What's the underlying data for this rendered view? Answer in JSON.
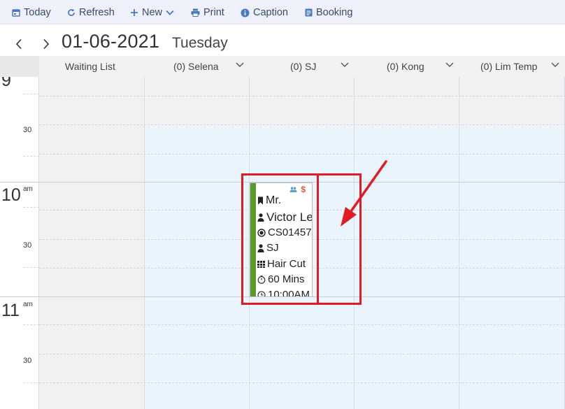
{
  "toolbar": {
    "today": "Today",
    "refresh": "Refresh",
    "new": "New",
    "print": "Print",
    "caption": "Caption",
    "booking": "Booking"
  },
  "date_header": {
    "date": "01-06-2021",
    "day": "Tuesday"
  },
  "columns": [
    {
      "label": "Waiting List"
    },
    {
      "label": "(0) Selena"
    },
    {
      "label": "(0) SJ"
    },
    {
      "label": "(0) Kong"
    },
    {
      "label": "(0) Lim Temp"
    }
  ],
  "time_labels": {
    "hour_9": "9",
    "half_1": "30",
    "hour_10": "10",
    "ampm_10": "am",
    "half_2": "30",
    "hour_11": "11",
    "ampm_11": "am",
    "half_3": "30"
  },
  "appointment": {
    "title": "Mr.",
    "name": "Victor Le",
    "code": "CS01457",
    "staff": "SJ",
    "service": "Hair Cut",
    "duration": "60 Mins",
    "time": "10:00AM",
    "price_symbol": "$",
    "bar_color": "#5a9a2a"
  },
  "colors": {
    "accent": "#3b4a6b",
    "annotation": "#e01b24",
    "grid_blue": "#e9f4fc"
  }
}
